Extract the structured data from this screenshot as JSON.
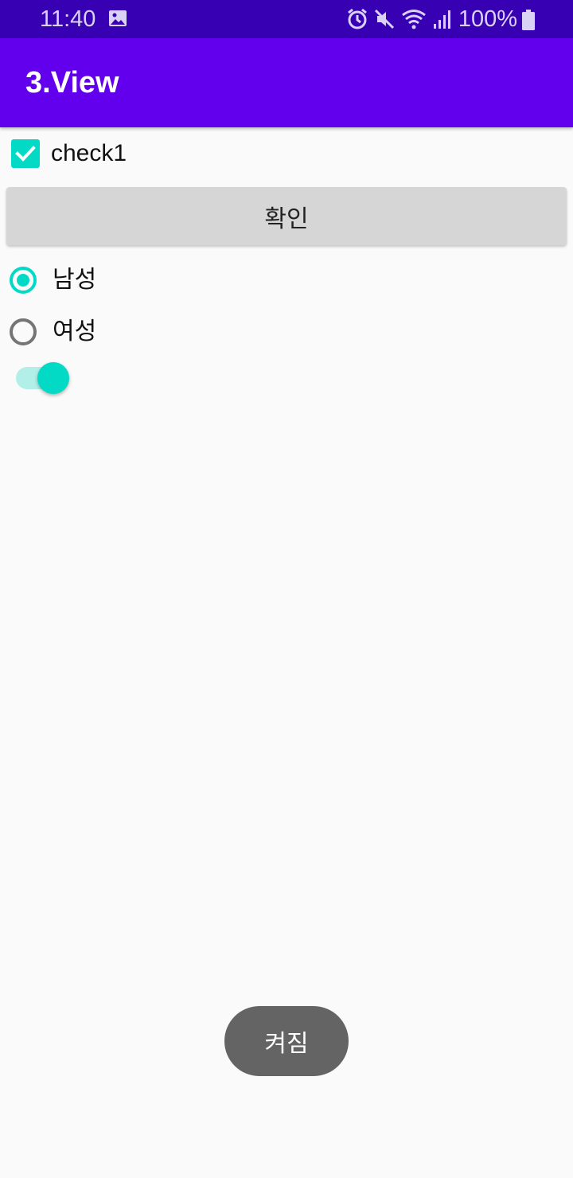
{
  "status_bar": {
    "time": "11:40",
    "battery": "100%",
    "icons": [
      "gallery-icon",
      "alarm-icon",
      "mute-icon",
      "wifi-icon",
      "signal-icon",
      "battery-icon"
    ],
    "colors": {
      "background": "#3700b3",
      "text": "#d9d2f5"
    }
  },
  "app_bar": {
    "title": "3.View",
    "color": "#6200ee"
  },
  "checkbox": {
    "label": "check1",
    "checked": true,
    "accent": "#03dac5"
  },
  "confirm_button": {
    "label": "확인"
  },
  "radio_group": {
    "options": [
      {
        "label": "남성",
        "checked": true
      },
      {
        "label": "여성",
        "checked": false
      }
    ]
  },
  "switch": {
    "on": true
  },
  "toast": {
    "text": "켜짐"
  }
}
